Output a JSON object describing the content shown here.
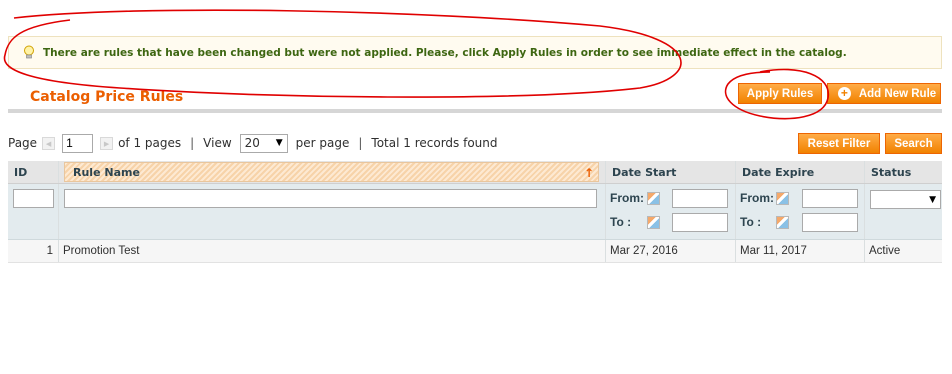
{
  "notice": {
    "text": "There are rules that have been changed but were not applied. Please, click Apply Rules in order to see immediate effect in the catalog.",
    "icon": "lightbulb-icon"
  },
  "header": {
    "title": "Catalog Price Rules",
    "apply_rules_label": "Apply Rules",
    "add_new_rule_label": "Add New Rule"
  },
  "pager": {
    "page_label": "Page",
    "current_page": "1",
    "of_pages": "of 1 pages",
    "view_label": "View",
    "per_page_value": "20",
    "per_page_label": "per page",
    "total": "Total 1 records found"
  },
  "actions": {
    "reset_filter_label": "Reset Filter",
    "search_label": "Search"
  },
  "grid": {
    "columns": [
      "ID",
      "Rule Name",
      "Date Start",
      "Date Expire",
      "Status"
    ],
    "filter": {
      "from_label": "From:",
      "to_label": "To :"
    },
    "rows": [
      {
        "id": "1",
        "name": "Promotion Test",
        "date_start": "Mar 27, 2016",
        "date_expire": "Mar 11, 2017",
        "status": "Active"
      }
    ]
  },
  "colors": {
    "accent": "#eb5e00",
    "button": "#f18200",
    "annotation": "#e00000"
  }
}
